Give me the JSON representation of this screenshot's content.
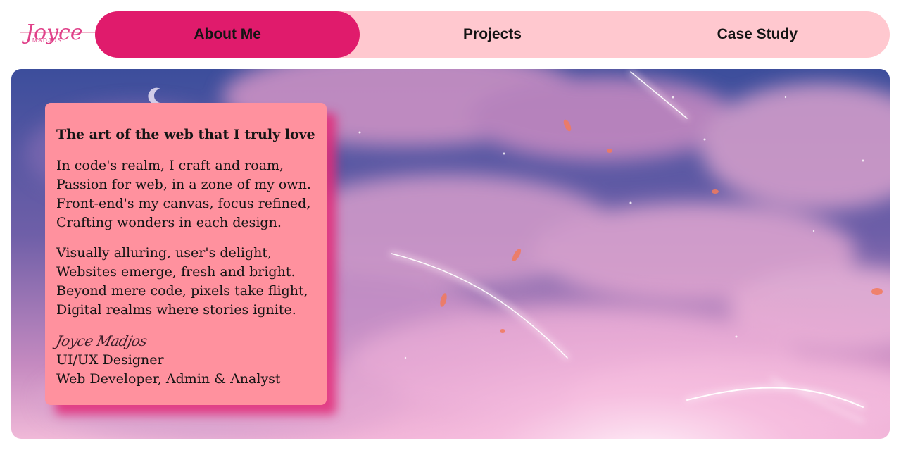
{
  "logo": {
    "name": "Joyce",
    "surname": "MADJOS"
  },
  "nav": {
    "tabs": [
      {
        "label": "About Me",
        "active": true
      },
      {
        "label": "Projects",
        "active": false
      },
      {
        "label": "Case Study",
        "active": false
      }
    ]
  },
  "card": {
    "title": "The art of the web that I truly love",
    "stanza1": [
      "In code's realm, I craft and roam,",
      "Passion for web, in a zone of my own.",
      "Front-end's my canvas, focus refined,",
      "Crafting wonders in each design."
    ],
    "stanza2": [
      "Visually alluring, user's delight,",
      "Websites emerge, fresh and bright.",
      "Beyond mere code, pixels take flight,",
      "Digital realms where stories ignite."
    ],
    "signature": "Joyce Madjos",
    "role1": "UI/UX Designer",
    "role2": "Web Developer, Admin & Analyst"
  },
  "colors": {
    "accent": "#e01b6c",
    "nav_bg": "#ffc8cf",
    "card_bg": "#ff919e"
  }
}
